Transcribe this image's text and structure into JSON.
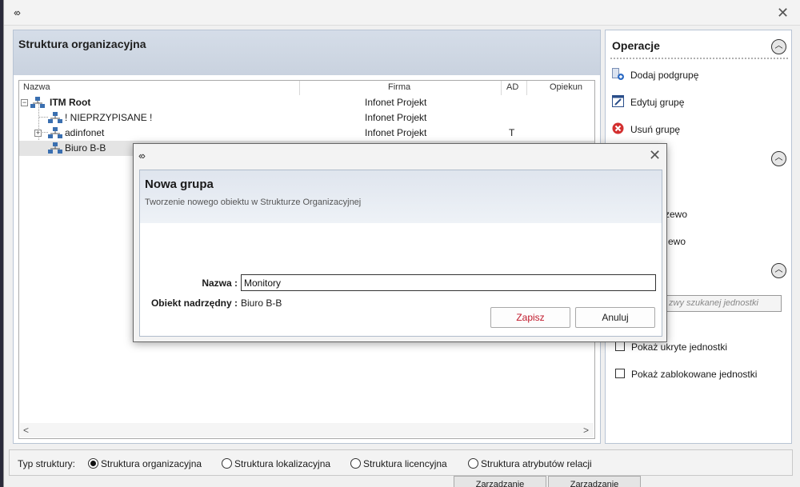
{
  "main": {
    "logo": "‹‹›",
    "close": "✕"
  },
  "structure": {
    "title": "Struktura organizacyjna",
    "columns": {
      "name": "Nazwa",
      "company": "Firma",
      "ad": "AD",
      "guardian": "Opiekun"
    },
    "rows": [
      {
        "name": "ITM Root",
        "company": "Infonet Projekt",
        "ad": ""
      },
      {
        "name": "! NIEPRZYPISANE !",
        "company": "Infonet Projekt",
        "ad": ""
      },
      {
        "name": "adinfonet",
        "company": "Infonet Projekt",
        "ad": "T"
      },
      {
        "name": "Biuro B-B",
        "company": "",
        "ad": ""
      }
    ],
    "scroll_left": "<",
    "scroll_right": ">"
  },
  "operations": {
    "title": "Operacje",
    "items": [
      {
        "label": "Dodaj podgrupę"
      },
      {
        "label": "Edytuj grupę"
      },
      {
        "label": "Usuń grupę"
      }
    ],
    "partial_item_1": "rzewo",
    "partial_item_2": "ewo",
    "search_placeholder": "zwy szukanej jednostki",
    "checks": [
      {
        "label": "Pokaż ukryte jednostki"
      },
      {
        "label": "Pokaż zablokowane jednostki"
      }
    ]
  },
  "struct_type": {
    "label": "Typ struktury:",
    "options": [
      {
        "label": "Struktura organizacyjna",
        "selected": true
      },
      {
        "label": "Struktura lokalizacyjna",
        "selected": false
      },
      {
        "label": "Struktura licencyjna",
        "selected": false
      },
      {
        "label": "Struktura atrybutów relacji",
        "selected": false
      }
    ]
  },
  "background_buttons": [
    "Zarządzanie",
    "Zarządzanie"
  ],
  "dialog": {
    "logo": "‹‹›",
    "close": "✕",
    "title": "Nowa grupa",
    "subtitle": "Tworzenie nowego obiektu w Strukturze Organizacyjnej",
    "name_label": "Nazwa :",
    "name_value": "Monitory",
    "parent_label": "Obiekt nadrzędny :",
    "parent_value": "Biuro B-B",
    "save": "Zapisz",
    "cancel": "Anuluj"
  },
  "colors": {
    "save_text": "#c0182a",
    "delete_icon": "#d32f2f",
    "net_icon": "#3a6fb0"
  }
}
